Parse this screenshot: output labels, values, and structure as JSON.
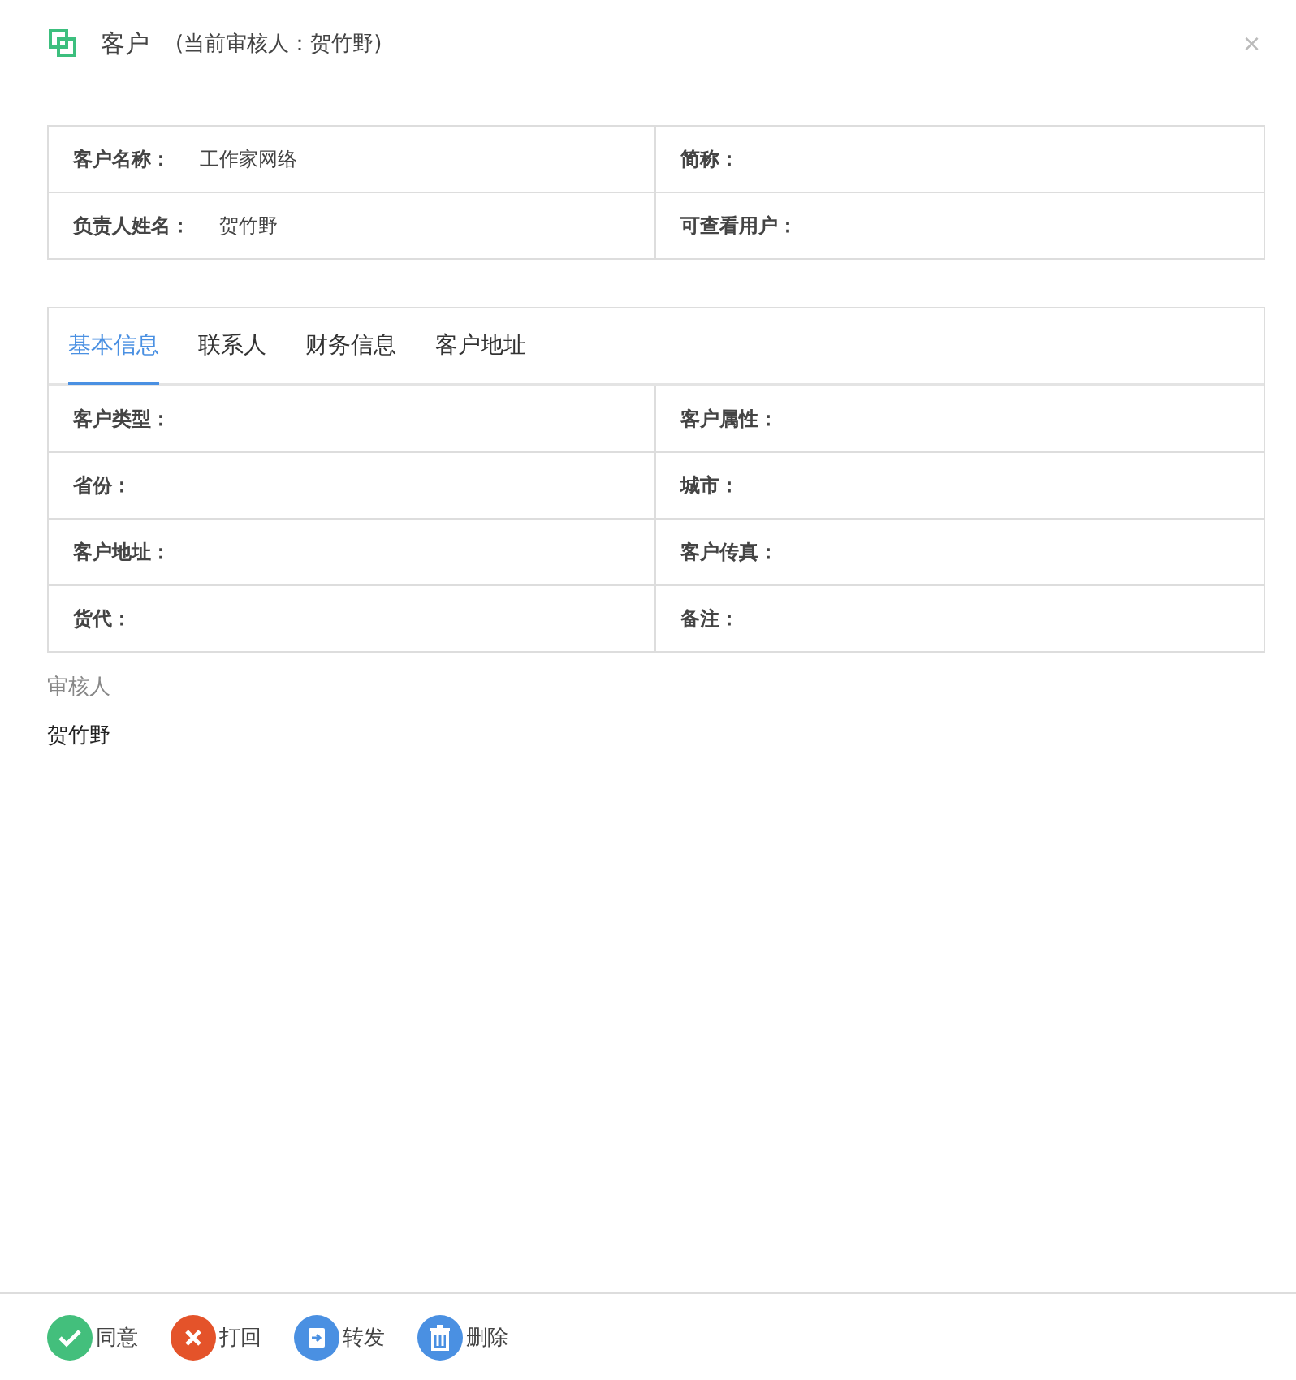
{
  "header": {
    "title": "客户",
    "subtitle": "(当前审核人：贺竹野)",
    "close": "×"
  },
  "summary": [
    {
      "label": "客户名称：",
      "value": "工作家网络"
    },
    {
      "label": "简称："
    },
    {
      "label": "负责人姓名：",
      "value": "贺竹野"
    },
    {
      "label": "可查看用户："
    }
  ],
  "tabs": [
    {
      "label": "基本信息",
      "selected": true
    },
    {
      "label": "联系人",
      "selected": false
    },
    {
      "label": "财务信息",
      "selected": false
    },
    {
      "label": "客户地址",
      "selected": false
    }
  ],
  "details": [
    {
      "label": "客户类型："
    },
    {
      "label": "客户属性："
    },
    {
      "label": "省份："
    },
    {
      "label": "城市："
    },
    {
      "label": "客户地址："
    },
    {
      "label": "客户传真："
    },
    {
      "label": "货代："
    },
    {
      "label": "备注："
    }
  ],
  "reviewer": {
    "label": "审核人",
    "name": "贺竹野"
  },
  "actions": [
    {
      "kind": "approve",
      "label": "同意"
    },
    {
      "kind": "reject",
      "label": "打回"
    },
    {
      "kind": "forward",
      "label": "转发"
    },
    {
      "kind": "delete",
      "label": "删除"
    }
  ]
}
